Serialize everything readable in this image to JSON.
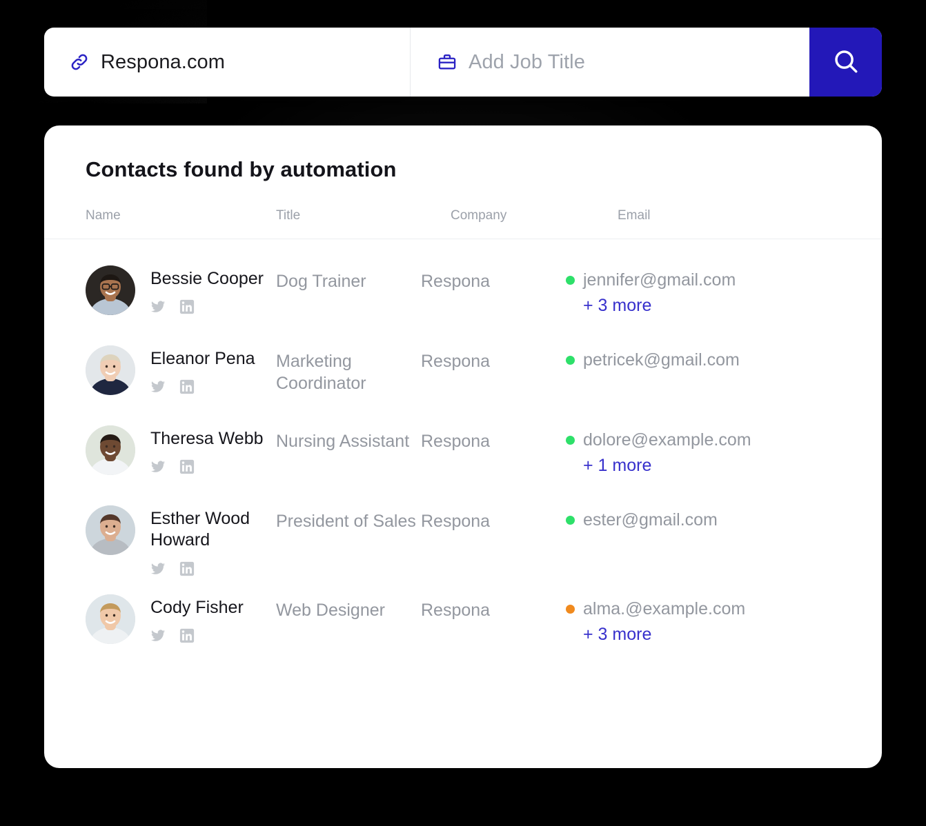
{
  "search": {
    "site_icon": "link-icon",
    "site_value": "Respona.com",
    "job_icon": "briefcase-icon",
    "job_placeholder": "Add Job Title",
    "job_value": "",
    "search_button_icon": "search-icon",
    "accent_color": "#2318b8"
  },
  "results": {
    "title": "Contacts found by automation",
    "columns": [
      "Name",
      "Title",
      "Company",
      "Email"
    ],
    "link_color": "#3730cc",
    "status_colors": {
      "verified": "#2ee06a",
      "risky": "#f08a1e"
    },
    "rows": [
      {
        "name": "Bessie Cooper",
        "title": "Dog Trainer",
        "company": "Respona",
        "email": "jennifer@gmail.com",
        "status": "verified",
        "more": "+ 3 more",
        "socials": [
          "twitter-icon",
          "linkedin-icon"
        ],
        "avatar": "avatar-bessie-cooper"
      },
      {
        "name": "Eleanor Pena",
        "title": "Marketing Coordinator",
        "company": "Respona",
        "email": "petricek@gmail.com",
        "status": "verified",
        "more": "",
        "socials": [
          "twitter-icon",
          "linkedin-icon"
        ],
        "avatar": "avatar-eleanor-pena"
      },
      {
        "name": "Theresa Webb",
        "title": "Nursing Assistant",
        "company": "Respona",
        "email": "dolore@example.com",
        "status": "verified",
        "more": "+ 1 more",
        "socials": [
          "twitter-icon",
          "linkedin-icon"
        ],
        "avatar": "avatar-theresa-webb"
      },
      {
        "name": "Esther Wood Howard",
        "title": "President of Sales",
        "company": "Respona",
        "email": "ester@gmail.com",
        "status": "verified",
        "more": "",
        "socials": [
          "twitter-icon",
          "linkedin-icon"
        ],
        "avatar": "avatar-esther-wood-howard"
      },
      {
        "name": "Cody Fisher",
        "title": "Web Designer",
        "company": "Respona",
        "email": "alma.@example.com",
        "status": "risky",
        "more": "+ 3 more",
        "socials": [
          "twitter-icon",
          "linkedin-icon"
        ],
        "avatar": "avatar-cody-fisher"
      }
    ]
  }
}
